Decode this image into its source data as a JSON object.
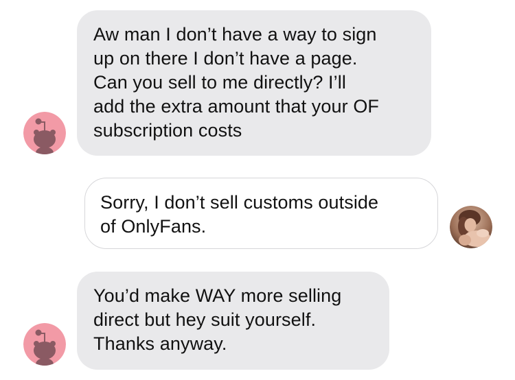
{
  "messages": [
    {
      "sender": "other",
      "lines": [
        "Aw man I don’t have a way to sign",
        "up on there I don’t have a page.",
        "Can you sell to me directly? I’ll",
        "add the extra amount that your OF",
        "subscription costs"
      ],
      "avatar_icon": "reddit-snoo-icon"
    },
    {
      "sender": "self",
      "lines": [
        "Sorry, I don’t sell customs outside",
        "of OnlyFans."
      ],
      "avatar_icon": "profile-photo"
    },
    {
      "sender": "other",
      "lines": [
        "You’d make WAY more selling",
        "direct but hey suit yourself.",
        "Thanks anyway."
      ],
      "avatar_icon": "reddit-snoo-icon"
    }
  ],
  "colors": {
    "received_bubble": "#e9e9eb",
    "sent_bubble": "#ffffff",
    "sent_border": "#d6d6d9",
    "text": "#111111",
    "avatar_bg": "#f29aa6",
    "avatar_figure": "#8a5a63"
  }
}
